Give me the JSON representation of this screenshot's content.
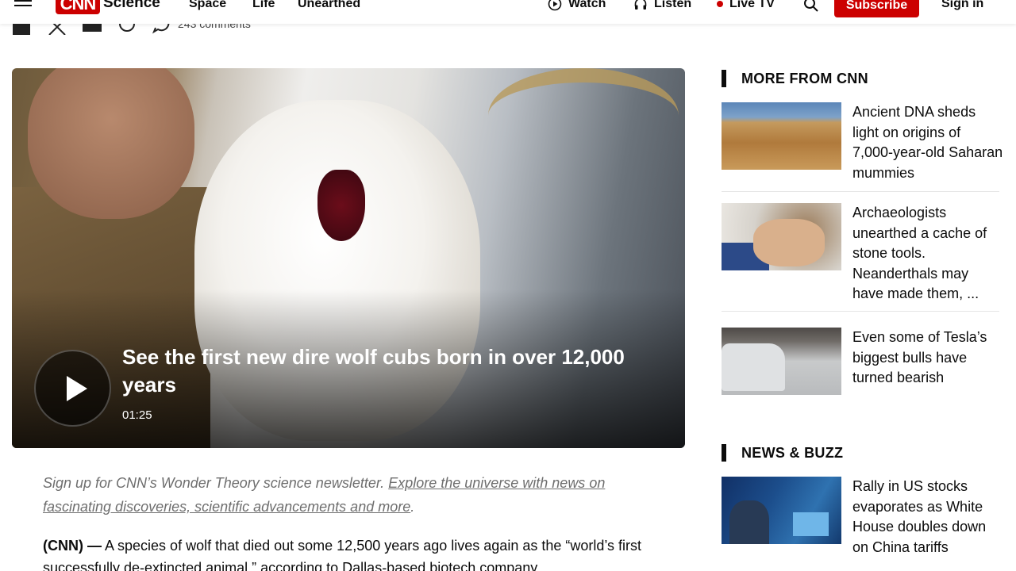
{
  "header": {
    "logo_text": "CNN",
    "section": "Science",
    "nav": [
      "Space",
      "Life",
      "Unearthed"
    ],
    "watch": "Watch",
    "listen": "Listen",
    "live_tv": "Live TV",
    "subscribe": "Subscribe",
    "sign_in": "Sign in"
  },
  "share": {
    "comments": "243 comments"
  },
  "video": {
    "title": "See the first new dire wolf cubs born in over 12,000 years",
    "duration": "01:25"
  },
  "article": {
    "newsletter_prefix": "Sign up for CNN’s Wonder Theory science newsletter. ",
    "newsletter_link": "Explore the universe with news on fascinating discoveries, scientific advancements and more",
    "newsletter_suffix": ".",
    "lead_source": "(CNN) —",
    "lead_text": " A species of wolf that died out some 12,500 years ago lives again as the “world’s first successfully de-extincted animal,” according to Dallas-based biotech company"
  },
  "sidebar": {
    "more_heading": "MORE FROM CNN",
    "more_items": [
      {
        "title": "Ancient DNA sheds light on origins of 7,000-year-old Saharan mummies"
      },
      {
        "title": "Archaeologists unearthed a cache of stone tools. Neanderthals may have made them, ..."
      },
      {
        "title": "Even some of Tesla’s biggest bulls have turned bearish"
      }
    ],
    "buzz_heading": "NEWS & BUZZ",
    "buzz_items": [
      {
        "title": "Rally in US stocks evaporates as White House doubles down on China tariffs"
      }
    ]
  },
  "colors": {
    "brand_red": "#cc0000"
  }
}
